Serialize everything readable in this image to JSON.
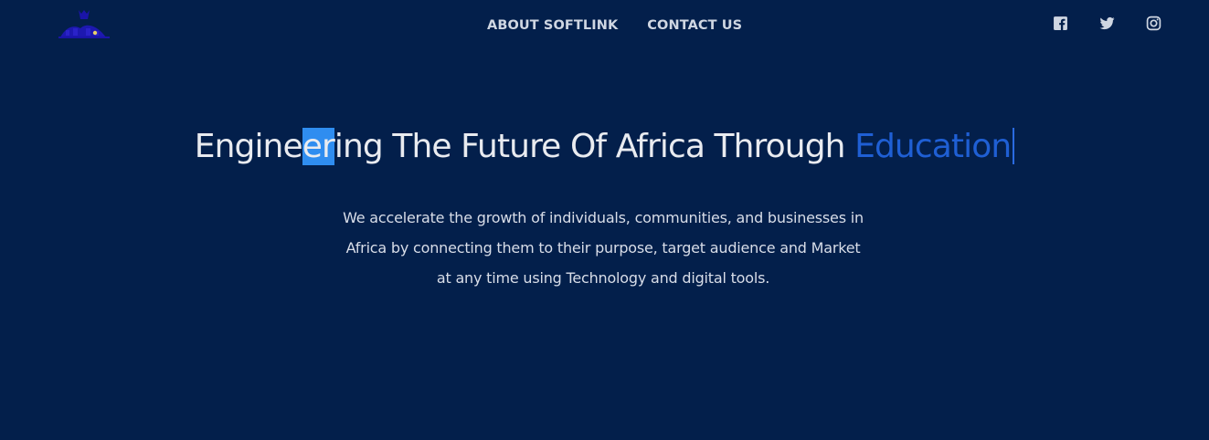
{
  "header": {
    "nav": {
      "about_label": "ABOUT SOFTLINK",
      "contact_label": "CONTACT US"
    },
    "social_icons": [
      "facebook-icon",
      "twitter-icon",
      "instagram-icon"
    ]
  },
  "hero": {
    "title_before_selection": "Engine",
    "title_selection": "er",
    "title_after_selection": "ing The Future Of Africa Through ",
    "title_accent": "Education",
    "description": "We accelerate the growth of individuals, communities, and businesses in Africa by connecting them to their purpose, target audience and Market at any time using Technology and digital tools."
  },
  "colors": {
    "background": "#031f4b",
    "accent": "#1f5fd4",
    "selection": "#2f8df0",
    "text": "#e9ebf0"
  }
}
